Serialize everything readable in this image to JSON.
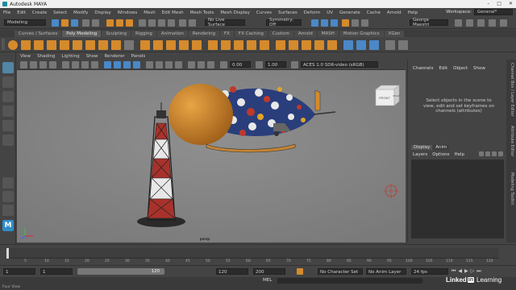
{
  "window": {
    "title": "Autodesk MAYA"
  },
  "menu": {
    "items": [
      "File",
      "Edit",
      "Create",
      "Select",
      "Modify",
      "Display",
      "Windows",
      "Mesh",
      "Edit Mesh",
      "Mesh Tools",
      "Mesh Display",
      "Curves",
      "Surfaces",
      "Deform",
      "UV",
      "Generate",
      "Cache",
      "Arnold",
      "Help"
    ],
    "workspace_label": "Workspace:",
    "workspace_value": "General*"
  },
  "status_line": {
    "mode_menu": "Modeling",
    "live_surface": "No Live Surface",
    "symmetry": "Symmetry: Off",
    "user": "George Maestri"
  },
  "shelf_tabs": [
    "Curves / Surfaces",
    "Poly Modeling",
    "Sculpting",
    "Rigging",
    "Animation",
    "Rendering",
    "FX",
    "FX Caching",
    "Custom",
    "Arnold",
    "MASH",
    "Motion Graphics",
    "XGen"
  ],
  "active_shelf_tab": "Poly Modeling",
  "viewport": {
    "menu": [
      "View",
      "Shading",
      "Lighting",
      "Show",
      "Renderer",
      "Panels"
    ],
    "field_a": "0.00",
    "field_b": "1.00",
    "color_space": "ACES 1.0 SDR-video (sRGB)",
    "camera_label": "persp",
    "viewcube_front": "FRONT",
    "viewcube_right": "RIGHT"
  },
  "channel_box": {
    "menu": [
      "Channels",
      "Edit",
      "Object",
      "Show"
    ],
    "message": "Select objects in the scene to view, edit and set keyframes on channels (attributes)"
  },
  "layer_editor": {
    "tabs": [
      "Display",
      "Anim"
    ],
    "menu": [
      "Layers",
      "Options",
      "Help"
    ]
  },
  "side_tabs": [
    "Channel Box / Layer Editor",
    "Attribute Editor",
    "Modeling Toolkit"
  ],
  "time_slider": {
    "ticks": [
      "5",
      "10",
      "15",
      "20",
      "25",
      "30",
      "35",
      "40",
      "45",
      "50",
      "55",
      "60",
      "65",
      "70",
      "75",
      "80",
      "85",
      "90",
      "95",
      "100",
      "105",
      "110",
      "115",
      "120"
    ],
    "current_frame": "1"
  },
  "range_slider": {
    "start_a": "1",
    "start_b": "1",
    "range_label": "120",
    "end_a": "120",
    "end_b": "200",
    "character_set": "No Character Set",
    "anim_layer": "No Anim Layer",
    "fps": "24 fps"
  },
  "command_line": {
    "label": "MEL"
  },
  "help_line": {
    "text": "Four View"
  },
  "watermark": {
    "brand": "Linked",
    "brand_in": "in",
    "learning": "Learning"
  },
  "colors": {
    "blimp_body": "#2a3e7c",
    "blimp_nose": "#d0892b",
    "tower_red": "#a8322b",
    "selection_blue": "#5285a6",
    "shelf_orange": "#d58a2c"
  }
}
